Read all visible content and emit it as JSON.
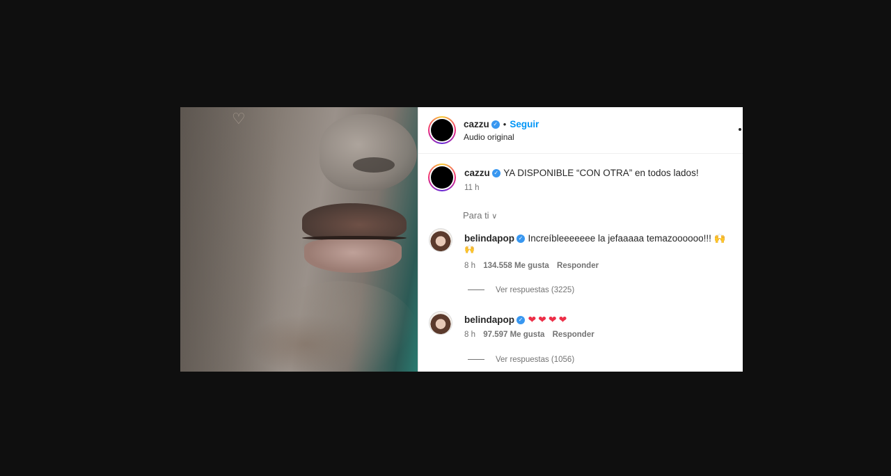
{
  "post": {
    "author": "cazzu",
    "verified": true,
    "follow_label": "Seguir",
    "separator": "•",
    "audio_label": "Audio original"
  },
  "caption": {
    "author": "cazzu",
    "text": "YA DISPONIBLE “CON OTRA” en todos lados!",
    "time": "11 h"
  },
  "sort": {
    "label": "Para ti",
    "chevron": "∨"
  },
  "comments": [
    {
      "author": "belindapop",
      "text_line1": "Increíbleeeeeee la jefaaaaa temazoooooo!!! 🙌",
      "text_line2": "🙌",
      "time": "8 h",
      "likes": "134.558 Me gusta",
      "reply_label": "Responder",
      "view_replies": "Ver respuestas (3225)"
    },
    {
      "author": "belindapop",
      "text_line1": "❤❤❤❤",
      "time": "8 h",
      "likes": "97.597 Me gusta",
      "reply_label": "Responder",
      "view_replies": "Ver respuestas (1056)"
    }
  ],
  "colors": {
    "background": "#0f0f0f",
    "link": "#0095f6",
    "verified": "#3897f0",
    "heart": "#ed2e47"
  }
}
